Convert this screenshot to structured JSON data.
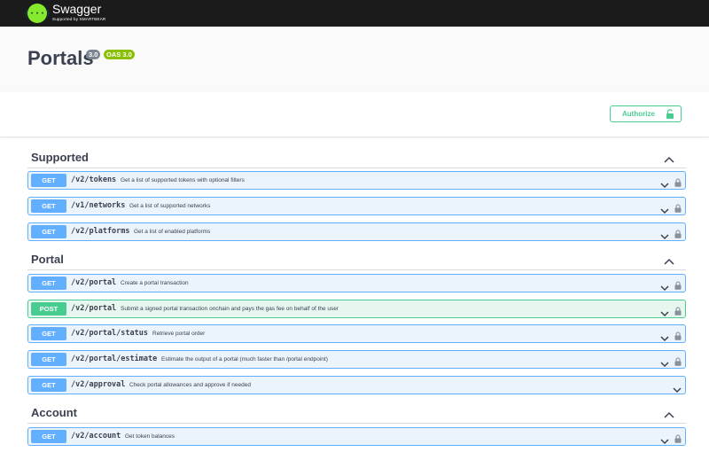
{
  "topbar": {
    "brand": "Swagger",
    "brand_sub": "Supported by SMARTBEAR",
    "logo_glyph": "{···}",
    "logo_color": "#85ea2d"
  },
  "info": {
    "title": "Portals",
    "version_badge": "3.0",
    "oas_badge": "OAS 3.0"
  },
  "authorize": {
    "label": "Authorize",
    "color": "#49cc90"
  },
  "colors": {
    "get": "#61affe",
    "post": "#49cc90"
  },
  "sections": [
    {
      "name": "Supported",
      "operations": [
        {
          "method": "GET",
          "path": "/v2/tokens",
          "summary": "Get a list of supported tokens with optional filters"
        },
        {
          "method": "GET",
          "path": "/v1/networks",
          "summary": "Get a list of supported networks"
        },
        {
          "method": "GET",
          "path": "/v2/platforms",
          "summary": "Get a list of enabled platforms"
        }
      ]
    },
    {
      "name": "Portal",
      "operations": [
        {
          "method": "GET",
          "path": "/v2/portal",
          "summary": "Create a portal transaction"
        },
        {
          "method": "POST",
          "path": "/v2/portal",
          "summary": "Submit a signed portal transaction onchain and pays the gas fee on behalf of the user"
        },
        {
          "method": "GET",
          "path": "/v2/portal/status",
          "summary": "Retrieve portal order"
        },
        {
          "method": "GET",
          "path": "/v2/portal/estimate",
          "summary": "Estimate the output of a portal (much faster than /portal endpoint)"
        },
        {
          "method": "GET",
          "path": "/v2/approval",
          "summary": "Check portal allowances and approve if needed"
        }
      ]
    },
    {
      "name": "Account",
      "operations": [
        {
          "method": "GET",
          "path": "/v2/account",
          "summary": "Get token balances"
        }
      ]
    }
  ]
}
